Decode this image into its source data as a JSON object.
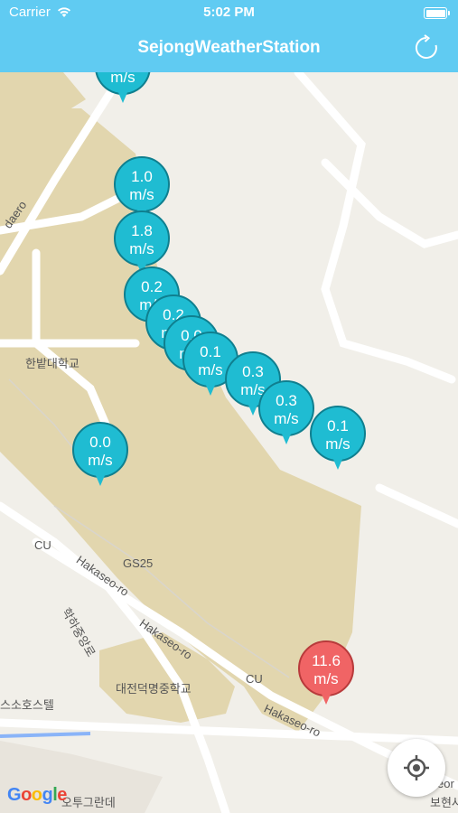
{
  "status_bar": {
    "carrier": "Carrier",
    "time": "5:02 PM"
  },
  "nav": {
    "title": "SejongWeatherStation",
    "refresh_icon": "refresh-icon"
  },
  "colors": {
    "accent": "#60cbf2",
    "pin_normal": "#1fbcd2",
    "pin_alert": "#f06465"
  },
  "markers": [
    {
      "value": "m/s",
      "type": "normal"
    },
    {
      "value": "1.0",
      "unit": "m/s",
      "type": "normal"
    },
    {
      "value": "1.8",
      "unit": "m/s",
      "type": "normal"
    },
    {
      "value": "0.2",
      "unit": "m/s",
      "type": "normal"
    },
    {
      "value": "0.2",
      "unit": "m/s",
      "type": "normal"
    },
    {
      "value": "0.0",
      "unit": "m/s",
      "type": "normal"
    },
    {
      "value": "0.1",
      "unit": "m/s",
      "type": "normal"
    },
    {
      "value": "0.3",
      "unit": "m/s",
      "type": "normal"
    },
    {
      "value": "0.3",
      "unit": "m/s",
      "type": "normal"
    },
    {
      "value": "0.1",
      "unit": "m/s",
      "type": "normal"
    },
    {
      "value": "0.0",
      "unit": "m/s",
      "type": "normal"
    },
    {
      "value": "11.6",
      "unit": "m/s",
      "type": "alert"
    }
  ],
  "map_labels": {
    "road_daero": "daero",
    "hanbat_univ": "한밭대학교",
    "cu_1": "CU",
    "gs25": "GS25",
    "hakaseo_1": "Hakaseo-ro",
    "hakaseo_2": "Hakaseo-ro",
    "hakaseo_3": "Hakaseo-ro",
    "hakhajung": "학하중앙로",
    "school": "대전덕명중학교",
    "cu_2": "CU",
    "hostel": "스소호스텔",
    "otu": "오투그란데",
    "edge_right": "eor",
    "edge_right2": "보현사"
  },
  "google_logo": "Google",
  "locate_button": "my-location-icon"
}
